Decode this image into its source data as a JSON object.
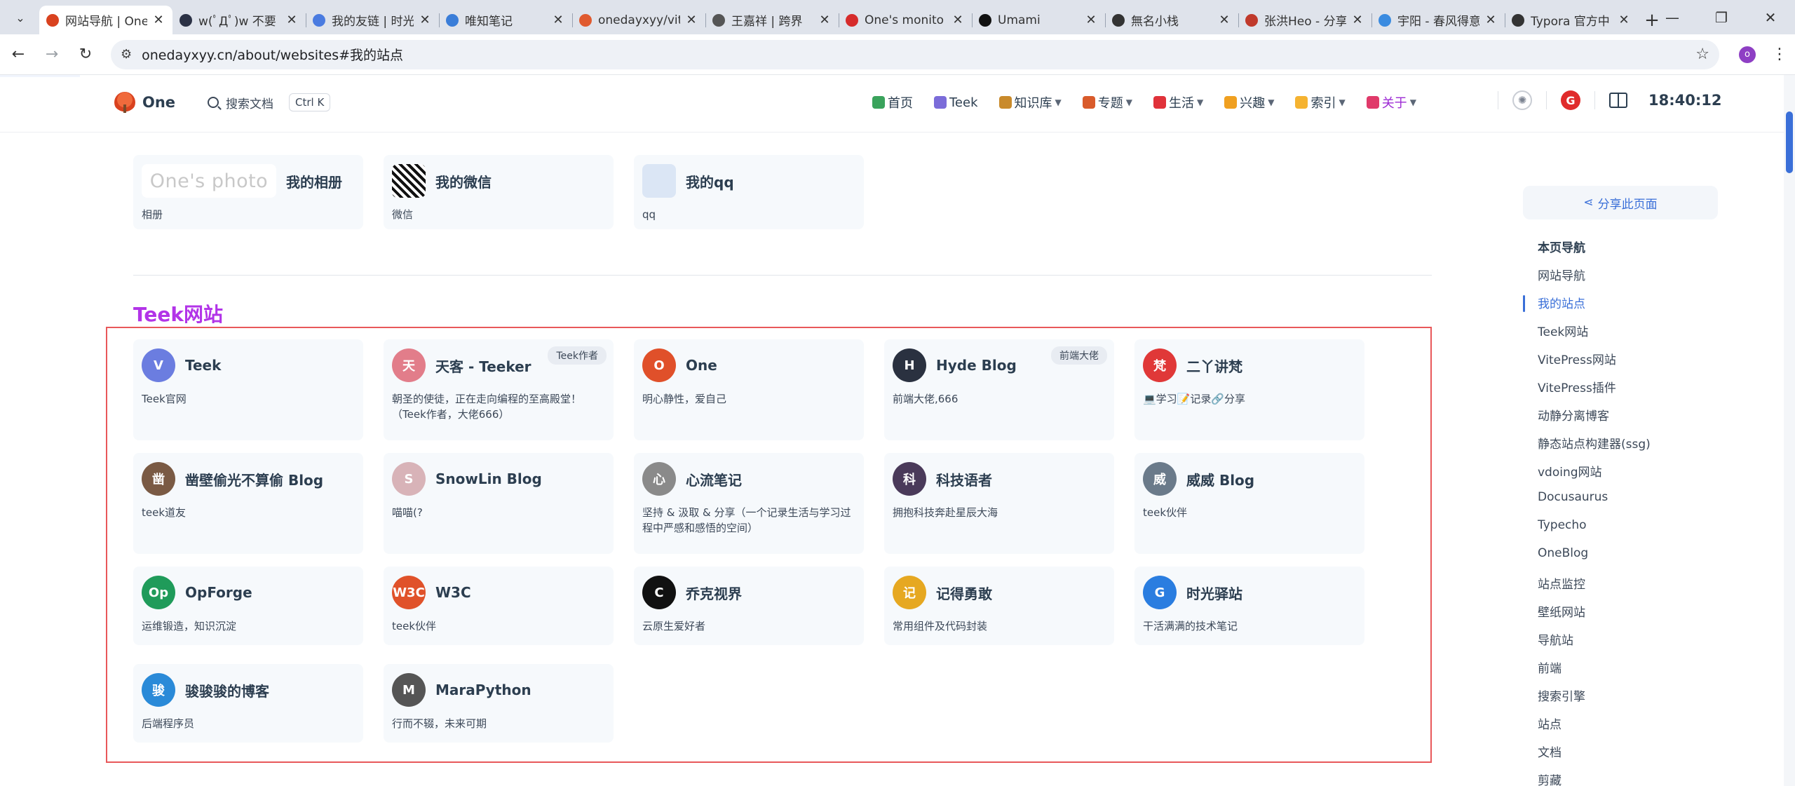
{
  "browser": {
    "tabs": [
      {
        "label": "网站导航 | One",
        "fav_color": "#d9421f",
        "active": true
      },
      {
        "label": "w(ﾟДﾟ)w 不要",
        "fav_color": "#2b3145",
        "active": false
      },
      {
        "label": "我的友链 | 时光",
        "fav_color": "#4a7be0",
        "active": false
      },
      {
        "label": "唯知笔记",
        "fav_color": "#3a7dd8",
        "active": false
      },
      {
        "label": "onedayxyy/vit",
        "fav_color": "#e05a2f",
        "active": false
      },
      {
        "label": "王嘉祥 | 跨界",
        "fav_color": "#555555",
        "active": false
      },
      {
        "label": "One's monito",
        "fav_color": "#d62b2b",
        "active": false
      },
      {
        "label": "Umami",
        "fav_color": "#111111",
        "active": false
      },
      {
        "label": "無名小栈",
        "fav_color": "#333333",
        "active": false
      },
      {
        "label": "张洪Heo - 分享",
        "fav_color": "#c0392b",
        "active": false
      },
      {
        "label": "宇阳 - 春风得意",
        "fav_color": "#3a8be0",
        "active": false
      },
      {
        "label": "Typora 官方中",
        "fav_color": "#333333",
        "active": false
      }
    ],
    "new_tab": "+",
    "window_controls": {
      "minimize": "—",
      "maximize": "❐",
      "close": "✕"
    },
    "url": "onedayxyy.cn/about/websites#我的站点",
    "profile_initial": "o"
  },
  "header": {
    "logo_text": "One",
    "search_label": "搜索文档",
    "search_kbd": "Ctrl K",
    "nav": [
      {
        "label": "首页",
        "icon_color": "#3aa35c",
        "caret": false,
        "active": false
      },
      {
        "label": "Teek",
        "icon_color": "#7b6cd9",
        "caret": false,
        "active": false
      },
      {
        "label": "知识库",
        "icon_color": "#c98a2b",
        "caret": true,
        "active": false
      },
      {
        "label": "专题",
        "icon_color": "#d95b2b",
        "caret": true,
        "active": false
      },
      {
        "label": "生活",
        "icon_color": "#e0323a",
        "caret": true,
        "active": false
      },
      {
        "label": "兴趣",
        "icon_color": "#f0a020",
        "caret": true,
        "active": false
      },
      {
        "label": "索引",
        "icon_color": "#f5b331",
        "caret": true,
        "active": false
      },
      {
        "label": "关于",
        "icon_color": "#e03a6a",
        "caret": true,
        "active": true
      }
    ],
    "red_badge": "G",
    "clock": "18:40:12"
  },
  "my_sites": [
    {
      "title": "我的相册",
      "desc": "相册",
      "photo_text": "One's photo"
    },
    {
      "title": "我的微信",
      "desc": "微信"
    },
    {
      "title": "我的qq",
      "desc": "qq"
    }
  ],
  "section": {
    "title": "Teek网站"
  },
  "teek_sites": [
    {
      "title": "Teek",
      "desc": "Teek官网",
      "badge": "",
      "icon_color": "#6b7de0",
      "icon_char": "V"
    },
    {
      "title": "天客 - Teeker",
      "desc": "朝圣的使徒，正在走向编程的至高殿堂！（Teek作者，大佬666）",
      "badge": "Teek作者",
      "icon_color": "#e27d8a",
      "icon_char": "天"
    },
    {
      "title": "One",
      "desc": "明心静性，爱自己",
      "badge": "",
      "icon_color": "#e0502a",
      "icon_char": "O"
    },
    {
      "title": "Hyde Blog",
      "desc": "前端大佬,666",
      "badge": "前端大佬",
      "icon_color": "#2a3140",
      "icon_char": "H"
    },
    {
      "title": "二丫讲梵",
      "desc": "💻学习📝记录🔗分享",
      "badge": "",
      "icon_color": "#e03838",
      "icon_char": "梵"
    },
    {
      "title": "凿壁偷光不算偷 Blog",
      "desc": "teek道友",
      "badge": "",
      "icon_color": "#7a5a44",
      "icon_char": "凿"
    },
    {
      "title": "SnowLin Blog",
      "desc": "喵喵(?",
      "badge": "",
      "icon_color": "#d8b3b8",
      "icon_char": "S"
    },
    {
      "title": "心流笔记",
      "desc": "坚持 & 汲取 & 分享（一个记录生活与学习过程中严感和感悟的空间）",
      "badge": "",
      "icon_color": "#8a8a8a",
      "icon_char": "心"
    },
    {
      "title": "科技语者",
      "desc": "拥抱科技奔赴星辰大海",
      "badge": "",
      "icon_color": "#4a3a5a",
      "icon_char": "科"
    },
    {
      "title": "威威 Blog",
      "desc": "teek伙伴",
      "badge": "",
      "icon_color": "#6a7a8a",
      "icon_char": "威"
    },
    {
      "title": "OpForge",
      "desc": "运维锻造，知识沉淀",
      "badge": "",
      "icon_color": "#1f9b5a",
      "icon_char": "Op"
    },
    {
      "title": "W3C",
      "desc": "teek伙伴",
      "badge": "",
      "icon_color": "#e0522a",
      "icon_char": "W3C"
    },
    {
      "title": "乔克视界",
      "desc": "云原生爱好者",
      "badge": "",
      "icon_color": "#111111",
      "icon_char": "C"
    },
    {
      "title": "记得勇敢",
      "desc": "常用组件及代码封装",
      "badge": "",
      "icon_color": "#e6a821",
      "icon_char": "记"
    },
    {
      "title": "时光驿站",
      "desc": "干活满满的技术笔记",
      "badge": "",
      "icon_color": "#2a7de0",
      "icon_char": "G"
    },
    {
      "title": "骏骏骏的博客",
      "desc": "后端程序员",
      "badge": "",
      "icon_color": "#2a8ad8",
      "icon_char": "骏"
    },
    {
      "title": "MaraPython",
      "desc": "行而不辍，未来可期",
      "badge": "",
      "icon_color": "#555555",
      "icon_char": "M"
    }
  ],
  "aside": {
    "share_label": "分享此页面",
    "toc_title": "本页导航",
    "toc": [
      "网站导航",
      "我的站点",
      "Teek网站",
      "VitePress网站",
      "VitePress插件",
      "动静分离博客",
      "静态站点构建器(ssg)",
      "vdoing网站",
      "Docusaurus",
      "Typecho",
      "OneBlog",
      "站点监控",
      "壁纸网站",
      "导航站",
      "前端",
      "搜索引擎",
      "站点",
      "文档",
      "剪藏"
    ],
    "toc_active_index": 1
  }
}
